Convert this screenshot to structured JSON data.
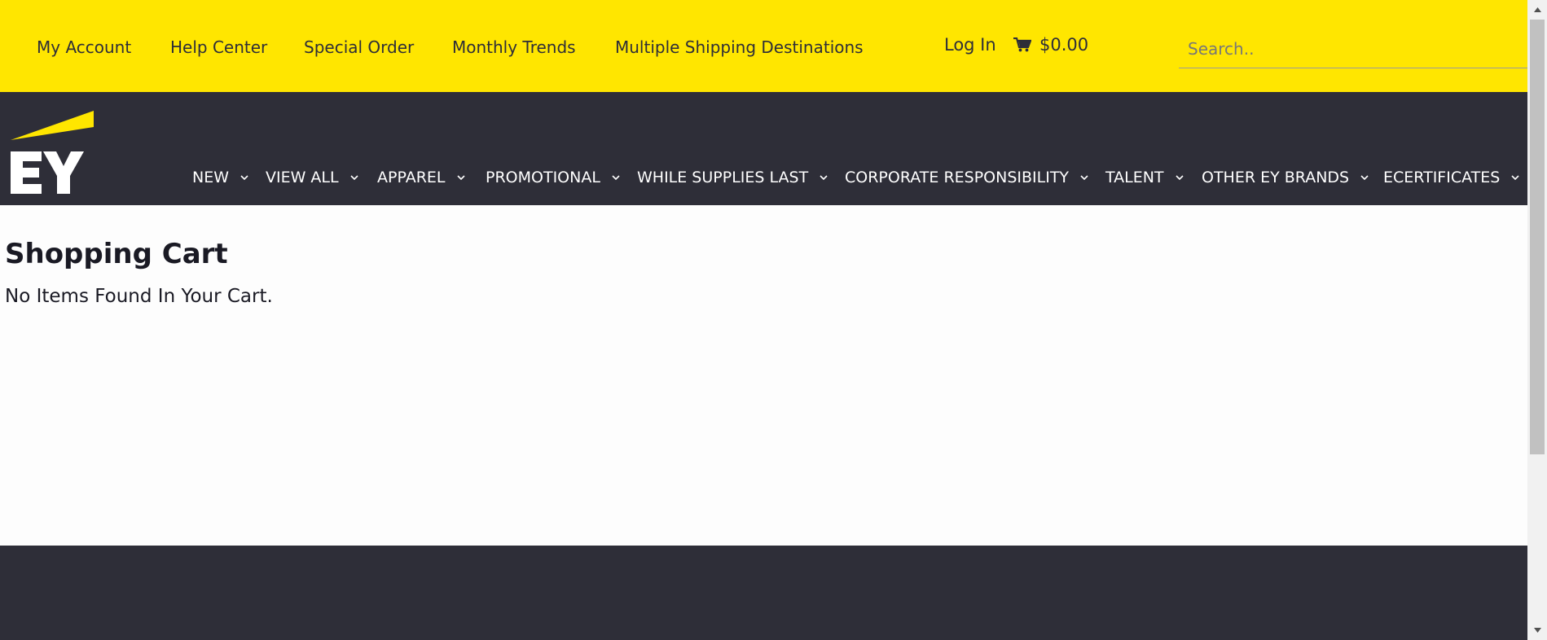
{
  "utility_nav": {
    "links": [
      {
        "label": "My Account"
      },
      {
        "label": "Help Center"
      },
      {
        "label": "Special Order"
      },
      {
        "label": "Monthly Trends"
      },
      {
        "label": "Multiple Shipping Destinations"
      }
    ],
    "login_label": "Log In",
    "cart_total": "$0.00",
    "search_placeholder": "Search.."
  },
  "main_nav": {
    "items": [
      {
        "label": "NEW"
      },
      {
        "label": "VIEW ALL"
      },
      {
        "label": "APPAREL"
      },
      {
        "label": "PROMOTIONAL"
      },
      {
        "label": "WHILE SUPPLIES LAST"
      },
      {
        "label": "CORPORATE RESPONSIBILITY"
      },
      {
        "label": "TALENT"
      },
      {
        "label": "OTHER EY BRANDS"
      },
      {
        "label": "ECERTIFICATES"
      }
    ]
  },
  "logo": {
    "text": "EY"
  },
  "page": {
    "title": "Shopping Cart",
    "empty_message": "No Items Found In Your Cart."
  },
  "colors": {
    "brand_yellow": "#ffe600",
    "brand_dark": "#2e2e38"
  },
  "icons": {
    "cart": "shopping-cart-icon",
    "chevron": "chevron-down-icon"
  }
}
